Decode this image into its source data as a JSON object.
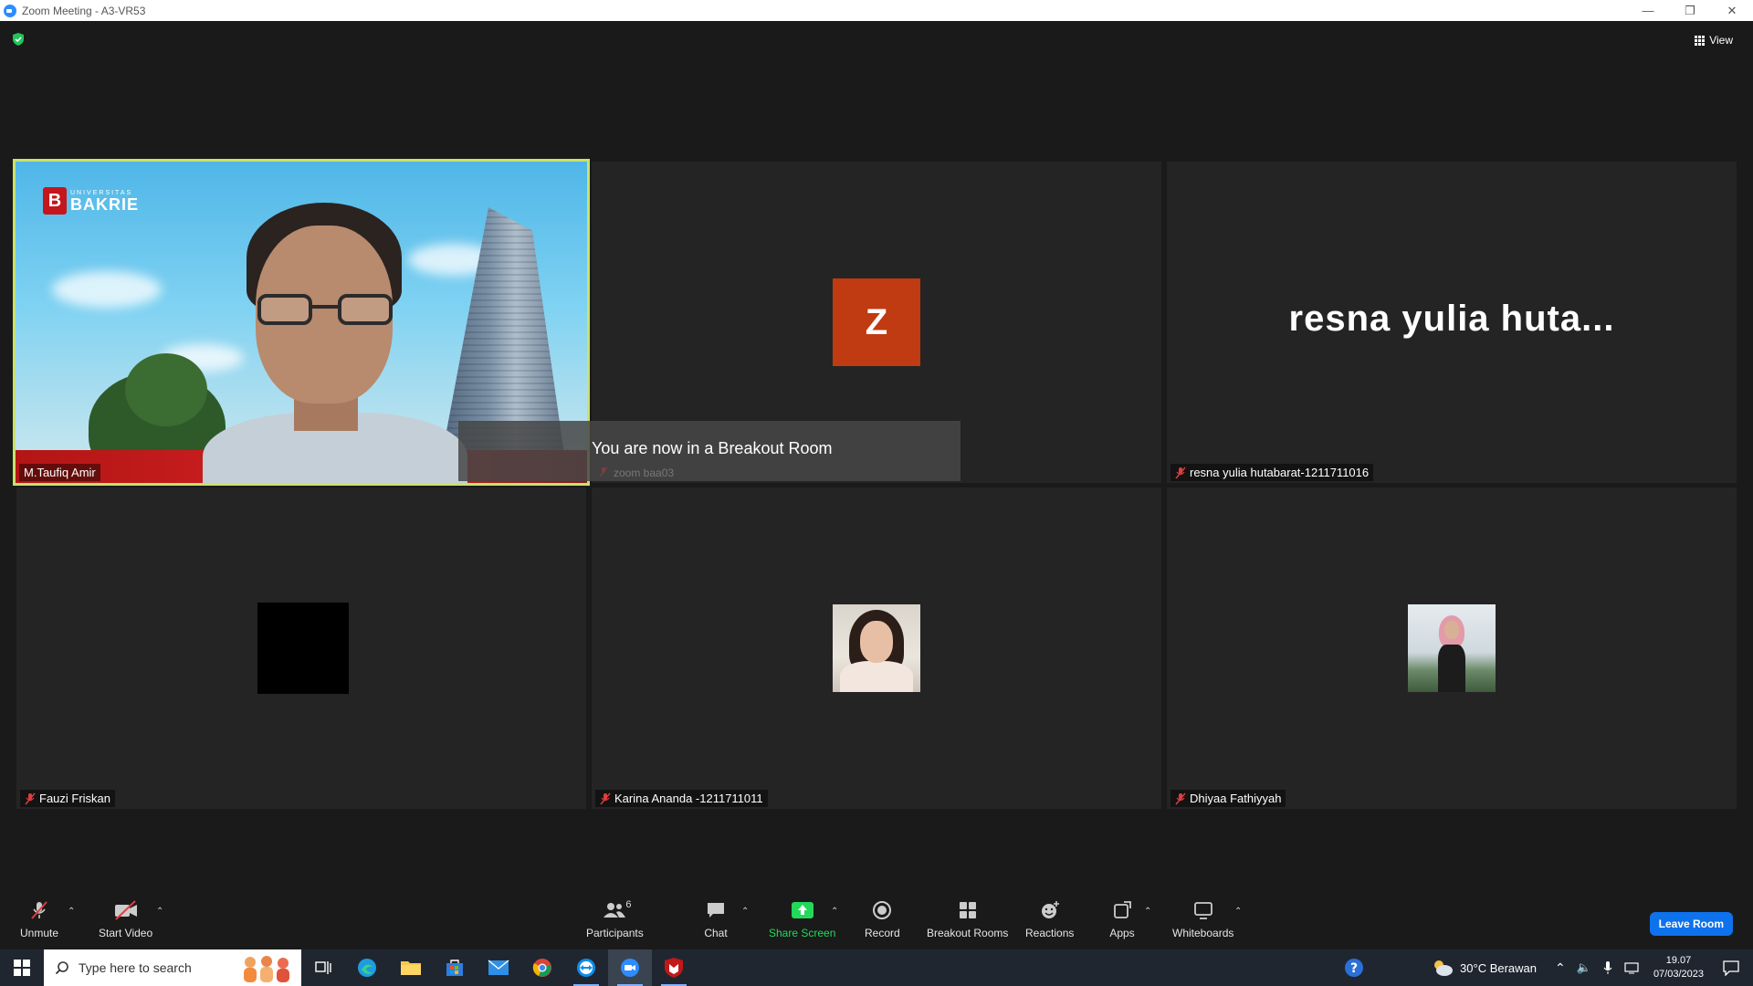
{
  "window": {
    "title": "Zoom Meeting - A3-VR53"
  },
  "top_right": {
    "view_label": "View"
  },
  "tiles": [
    {
      "name": "M.Taufiq Amir",
      "logo_small": "UNIVERSITAS",
      "logo_big": "BAKRIE",
      "logo_mark": "B"
    },
    {
      "name": "zoom baa03",
      "avatar_letter": "Z"
    },
    {
      "name": "resna yulia hutabarat-1211711016",
      "display_name": "resna yulia huta..."
    },
    {
      "name": "Fauzi Friskan"
    },
    {
      "name": "Karina Ananda -1211711011"
    },
    {
      "name": "Dhiyaa Fathiyyah"
    }
  ],
  "banner": {
    "message": "You are now in a Breakout Room"
  },
  "toolbar": {
    "unmute": "Unmute",
    "start_video": "Start Video",
    "participants": "Participants",
    "participants_count": "6",
    "chat": "Chat",
    "share_screen": "Share Screen",
    "record": "Record",
    "breakout_rooms": "Breakout Rooms",
    "reactions": "Reactions",
    "apps": "Apps",
    "whiteboards": "Whiteboards",
    "leave_room": "Leave Room"
  },
  "taskbar": {
    "search_placeholder": "Type here to search",
    "weather": "30°C  Berawan",
    "time": "19.07",
    "date": "07/03/2023"
  },
  "colors": {
    "active_speaker_border": "#c8e26a",
    "avatar_z": "#c03a12",
    "share_green": "#23d959",
    "leave_blue": "#0e72ed"
  }
}
